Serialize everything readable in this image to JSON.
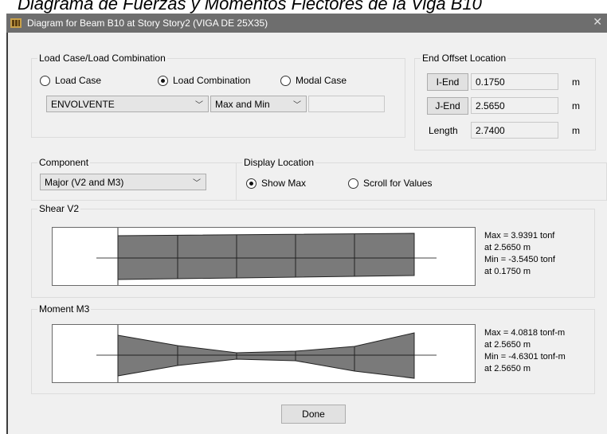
{
  "caption": "Diagrama de Fuerzas y Momentos Flectores de la Viga B10",
  "window": {
    "title": "Diagram for Beam B10 at Story Story2 (VIGA DE 25X35)",
    "close_glyph": "✕"
  },
  "load_case_group": {
    "label": "Load Case/Load Combination",
    "radios": [
      {
        "label": "Load Case",
        "selected": false
      },
      {
        "label": "Load Combination",
        "selected": true
      },
      {
        "label": "Modal Case",
        "selected": false
      }
    ],
    "combination_value": "ENVOLVENTE",
    "envelope_value": "Max and Min",
    "extra_value": ""
  },
  "end_offset": {
    "label": "End Offset Location",
    "i_end_label": "I-End",
    "i_end_value": "0.1750",
    "i_end_unit": "m",
    "j_end_label": "J-End",
    "j_end_value": "2.5650",
    "j_end_unit": "m",
    "length_label": "Length",
    "length_value": "2.7400",
    "length_unit": "m"
  },
  "component": {
    "label": "Component",
    "value": "Major (V2 and M3)"
  },
  "display_location": {
    "label": "Display Location",
    "options": [
      {
        "label": "Show Max",
        "selected": true
      },
      {
        "label": "Scroll for Values",
        "selected": false
      }
    ]
  },
  "shear": {
    "label": "Shear V2",
    "max_text": "Max = 3.9391 tonf",
    "max_at": "at 2.5650 m",
    "min_text": "Min = -3.5450 tonf",
    "min_at": "at 0.1750 m"
  },
  "moment": {
    "label": "Moment M3",
    "max_text": "Max = 4.0818 tonf-m",
    "max_at": "at 2.5650 m",
    "min_text": "Min = -4.6301 tonf-m",
    "min_at": "at 2.5650 m"
  },
  "done_label": "Done",
  "colors": {
    "diagram_fill": "#7a7a7a",
    "titlebar": "#6e6e6e",
    "dialog_bg": "#f0f0f0"
  },
  "chart_data": [
    {
      "type": "area",
      "title": "Shear V2",
      "xlabel": "",
      "ylabel": "",
      "x": [
        0.175,
        2.565
      ],
      "series": [
        {
          "values": [
            -3.545,
            3.9391
          ]
        },
        {
          "values": [
            3.545,
            -3.9391
          ]
        }
      ]
    },
    {
      "type": "area",
      "title": "Moment M3",
      "x": [
        0.175,
        1.37,
        2.565
      ],
      "series": [
        {
          "values": [
            -4.6301,
            -0.6,
            4.0818
          ]
        },
        {
          "values": [
            4.6301,
            0.6,
            -4.0818
          ]
        }
      ]
    }
  ]
}
